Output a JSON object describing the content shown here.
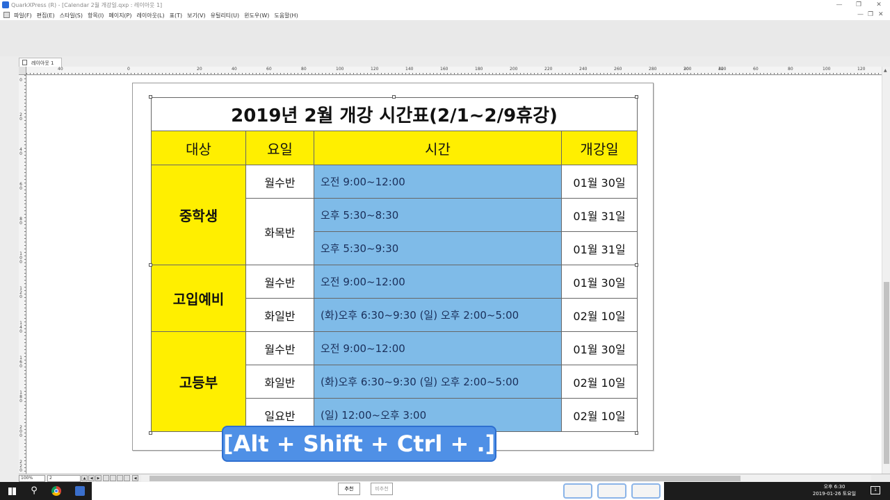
{
  "window": {
    "title": "QuarkXPress (R) - [Calendar 2월 개강일.qxp : 레이아웃 1]"
  },
  "menu": [
    "파일(F)",
    "편집(E)",
    "스타일(S)",
    "항목(I)",
    "페이지(P)",
    "레이아웃(L)",
    "표(T)",
    "보기(V)",
    "유틸리티(U)",
    "윈도우(W)",
    "도움말(H)"
  ],
  "layout_tab": "레이아웃 1",
  "ruler": {
    "h_ticks": [
      "40",
      "0",
      "20",
      "40",
      "60",
      "80",
      "100",
      "120",
      "140",
      "160",
      "180",
      "200",
      "220",
      "240",
      "260",
      "280",
      "300",
      "320",
      "20",
      "40",
      "60",
      "80",
      "100",
      "120"
    ],
    "v_ticks": [
      "0",
      "2 0",
      "4 0",
      "6 0",
      "8 0",
      "1 0 0",
      "1 2 0",
      "1 4 0",
      "1 6 0",
      "1 8 0",
      "2 0 0",
      "2 2 0"
    ]
  },
  "table": {
    "title": "2019년 2월 개강 시간표(2/1~2/9휴강)",
    "headers": [
      "대상",
      "요일",
      "시간",
      "개강일"
    ],
    "groups": [
      {
        "name": "중학생",
        "rows": [
          {
            "day": "월수반",
            "time": "오전 9:00~12:00",
            "date": "01월 30일"
          },
          {
            "day": "화목반",
            "time": "오후 5:30~8:30",
            "date": "01월 31일"
          },
          {
            "day": "",
            "time": "오후 5:30~9:30",
            "date": "01월 31일"
          }
        ]
      },
      {
        "name": "고입예비",
        "rows": [
          {
            "day": "월수반",
            "time": "오전 9:00~12:00",
            "date": "01월 30일"
          },
          {
            "day": "화일반",
            "time": "(화)오후 6:30~9:30 (일) 오후 2:00~5:00",
            "date": "02월 10일"
          }
        ]
      },
      {
        "name": "고등부",
        "rows": [
          {
            "day": "월수반",
            "time": "오전 9:00~12:00",
            "date": "01월 30일"
          },
          {
            "day": "화일반",
            "time": "(화)오후 6:30~9:30 (일) 오후 2:00~5:00",
            "date": "02월 10일"
          },
          {
            "day": "일요반",
            "time": "(일) 12:00~오후 3:00",
            "date": "02월 10일"
          }
        ]
      }
    ]
  },
  "overlay": "[Alt + Shift + Ctrl + .]",
  "status": {
    "zoom": "100%",
    "page": "2"
  },
  "taskbar": {
    "btn1": "추천",
    "btn2": "비추천",
    "time": "오후 6:30",
    "date": "2019-01-26 토요일",
    "notif_count": "1"
  },
  "colors": {
    "header_yellow": "#ffef00",
    "time_blue": "#7fbbe8",
    "overlay_blue": "#4f90e6"
  }
}
